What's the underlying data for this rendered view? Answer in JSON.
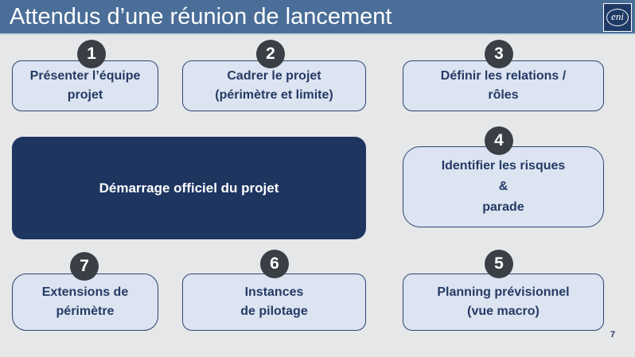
{
  "slide": {
    "title": "Attendus d’une réunion de lancement",
    "logo_text": "eni",
    "page_number": "7"
  },
  "center": {
    "label": "Démarrage officiel du projet"
  },
  "steps": [
    {
      "number": "1",
      "label": "Présenter l’équipe\nprojet"
    },
    {
      "number": "2",
      "label": "Cadrer le projet\n(périmètre et limite)"
    },
    {
      "number": "3",
      "label": "Définir les relations /\nrôles"
    },
    {
      "number": "4",
      "label": "Identifier les risques\n&\nparade"
    },
    {
      "number": "5",
      "label": "Planning prévisionnel\n(vue macro)"
    },
    {
      "number": "6",
      "label": "Instances\nde pilotage"
    },
    {
      "number": "7",
      "label": "Extensions de\npérimètre"
    }
  ],
  "colors": {
    "title_bar": "#4a6e98",
    "box_fill": "#dce4f2",
    "box_border": "#2d4470",
    "center_fill": "#1e3560",
    "badge": "#3a3f46"
  }
}
